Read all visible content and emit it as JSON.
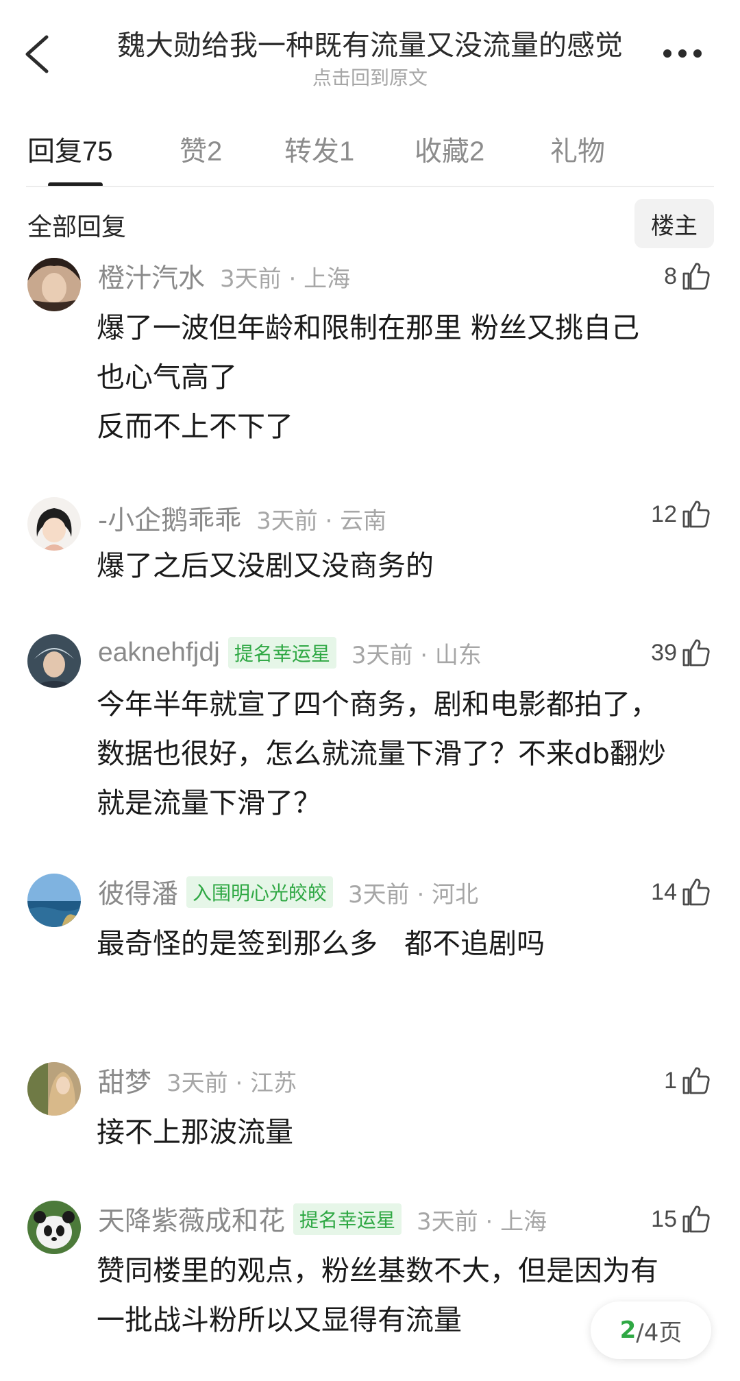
{
  "header": {
    "title": "魏大勋给我一种既有流量又没流量的感觉",
    "subtitle": "点击回到原文"
  },
  "tabs": [
    {
      "label": "回复",
      "count": "75"
    },
    {
      "label": "赞",
      "count": "2"
    },
    {
      "label": "转发",
      "count": "1"
    },
    {
      "label": "收藏",
      "count": "2"
    },
    {
      "label": "礼物",
      "count": ""
    }
  ],
  "section": {
    "title": "全部回复",
    "op_filter_label": "楼主"
  },
  "comments": [
    {
      "name": "橙汁汽水",
      "badge": "",
      "time": "3天前",
      "location": "上海",
      "likes": "8",
      "lines": [
        "爆了一波但年龄和限制在那里 粉丝又挑自己",
        "也心气高了",
        "反而不上不下了"
      ]
    },
    {
      "name": "-小企鹅乖乖",
      "badge": "",
      "time": "3天前",
      "location": "云南",
      "likes": "12",
      "lines": [
        "爆了之后又没剧又没商务的"
      ]
    },
    {
      "name": "eaknehfjdj",
      "badge": "提名幸运星",
      "time": "3天前",
      "location": "山东",
      "likes": "39",
      "lines": [
        "今年半年就宣了四个商务，剧和电影都拍了，",
        "数据也很好，怎么就流量下滑了？不来db翻炒",
        "就是流量下滑了？"
      ]
    },
    {
      "name": "彼得潘",
      "badge": "入围明心光皎皎",
      "time": "3天前",
      "location": "河北",
      "likes": "14",
      "lines": [
        "最奇怪的是签到那么多   都不追剧吗"
      ]
    },
    {
      "name": "甜梦",
      "badge": "",
      "time": "3天前",
      "location": "江苏",
      "likes": "1",
      "lines": [
        "接不上那波流量"
      ]
    },
    {
      "name": "天降紫薇成和花",
      "badge": "提名幸运星",
      "time": "3天前",
      "location": "上海",
      "likes": "15",
      "lines": [
        "赞同楼里的观点，粉丝基数不大，但是因为有",
        "一批战斗粉所以又显得有流量"
      ]
    }
  ],
  "pager": {
    "current": "2",
    "total_label": "/4页"
  },
  "colors": {
    "accent_green": "#2fa844",
    "badge_bg": "#e6f6e8"
  }
}
